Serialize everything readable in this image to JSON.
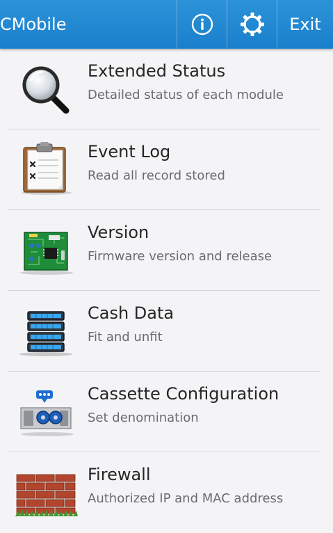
{
  "app": {
    "title": "CMobile"
  },
  "action_bar": {
    "info_icon": "info-icon",
    "settings_icon": "gear-icon",
    "exit_label": "Exit",
    "color": "#1f86d0"
  },
  "menu": {
    "items": [
      {
        "title": "Extended Status",
        "subtitle": "Detailed status of each module",
        "icon": "magnifier-icon"
      },
      {
        "title": "Event Log",
        "subtitle": "Read all record stored",
        "icon": "clipboard-icon"
      },
      {
        "title": "Version",
        "subtitle": "Firmware version and release",
        "icon": "circuit-board-icon"
      },
      {
        "title": "Cash Data",
        "subtitle": "Fit and unfit",
        "icon": "server-rack-icon"
      },
      {
        "title": "Cassette Configuration",
        "subtitle": "Set denomination",
        "icon": "cassette-icon"
      },
      {
        "title": "Firewall",
        "subtitle": "Authorized IP and MAC address",
        "icon": "brick-wall-icon"
      }
    ]
  }
}
